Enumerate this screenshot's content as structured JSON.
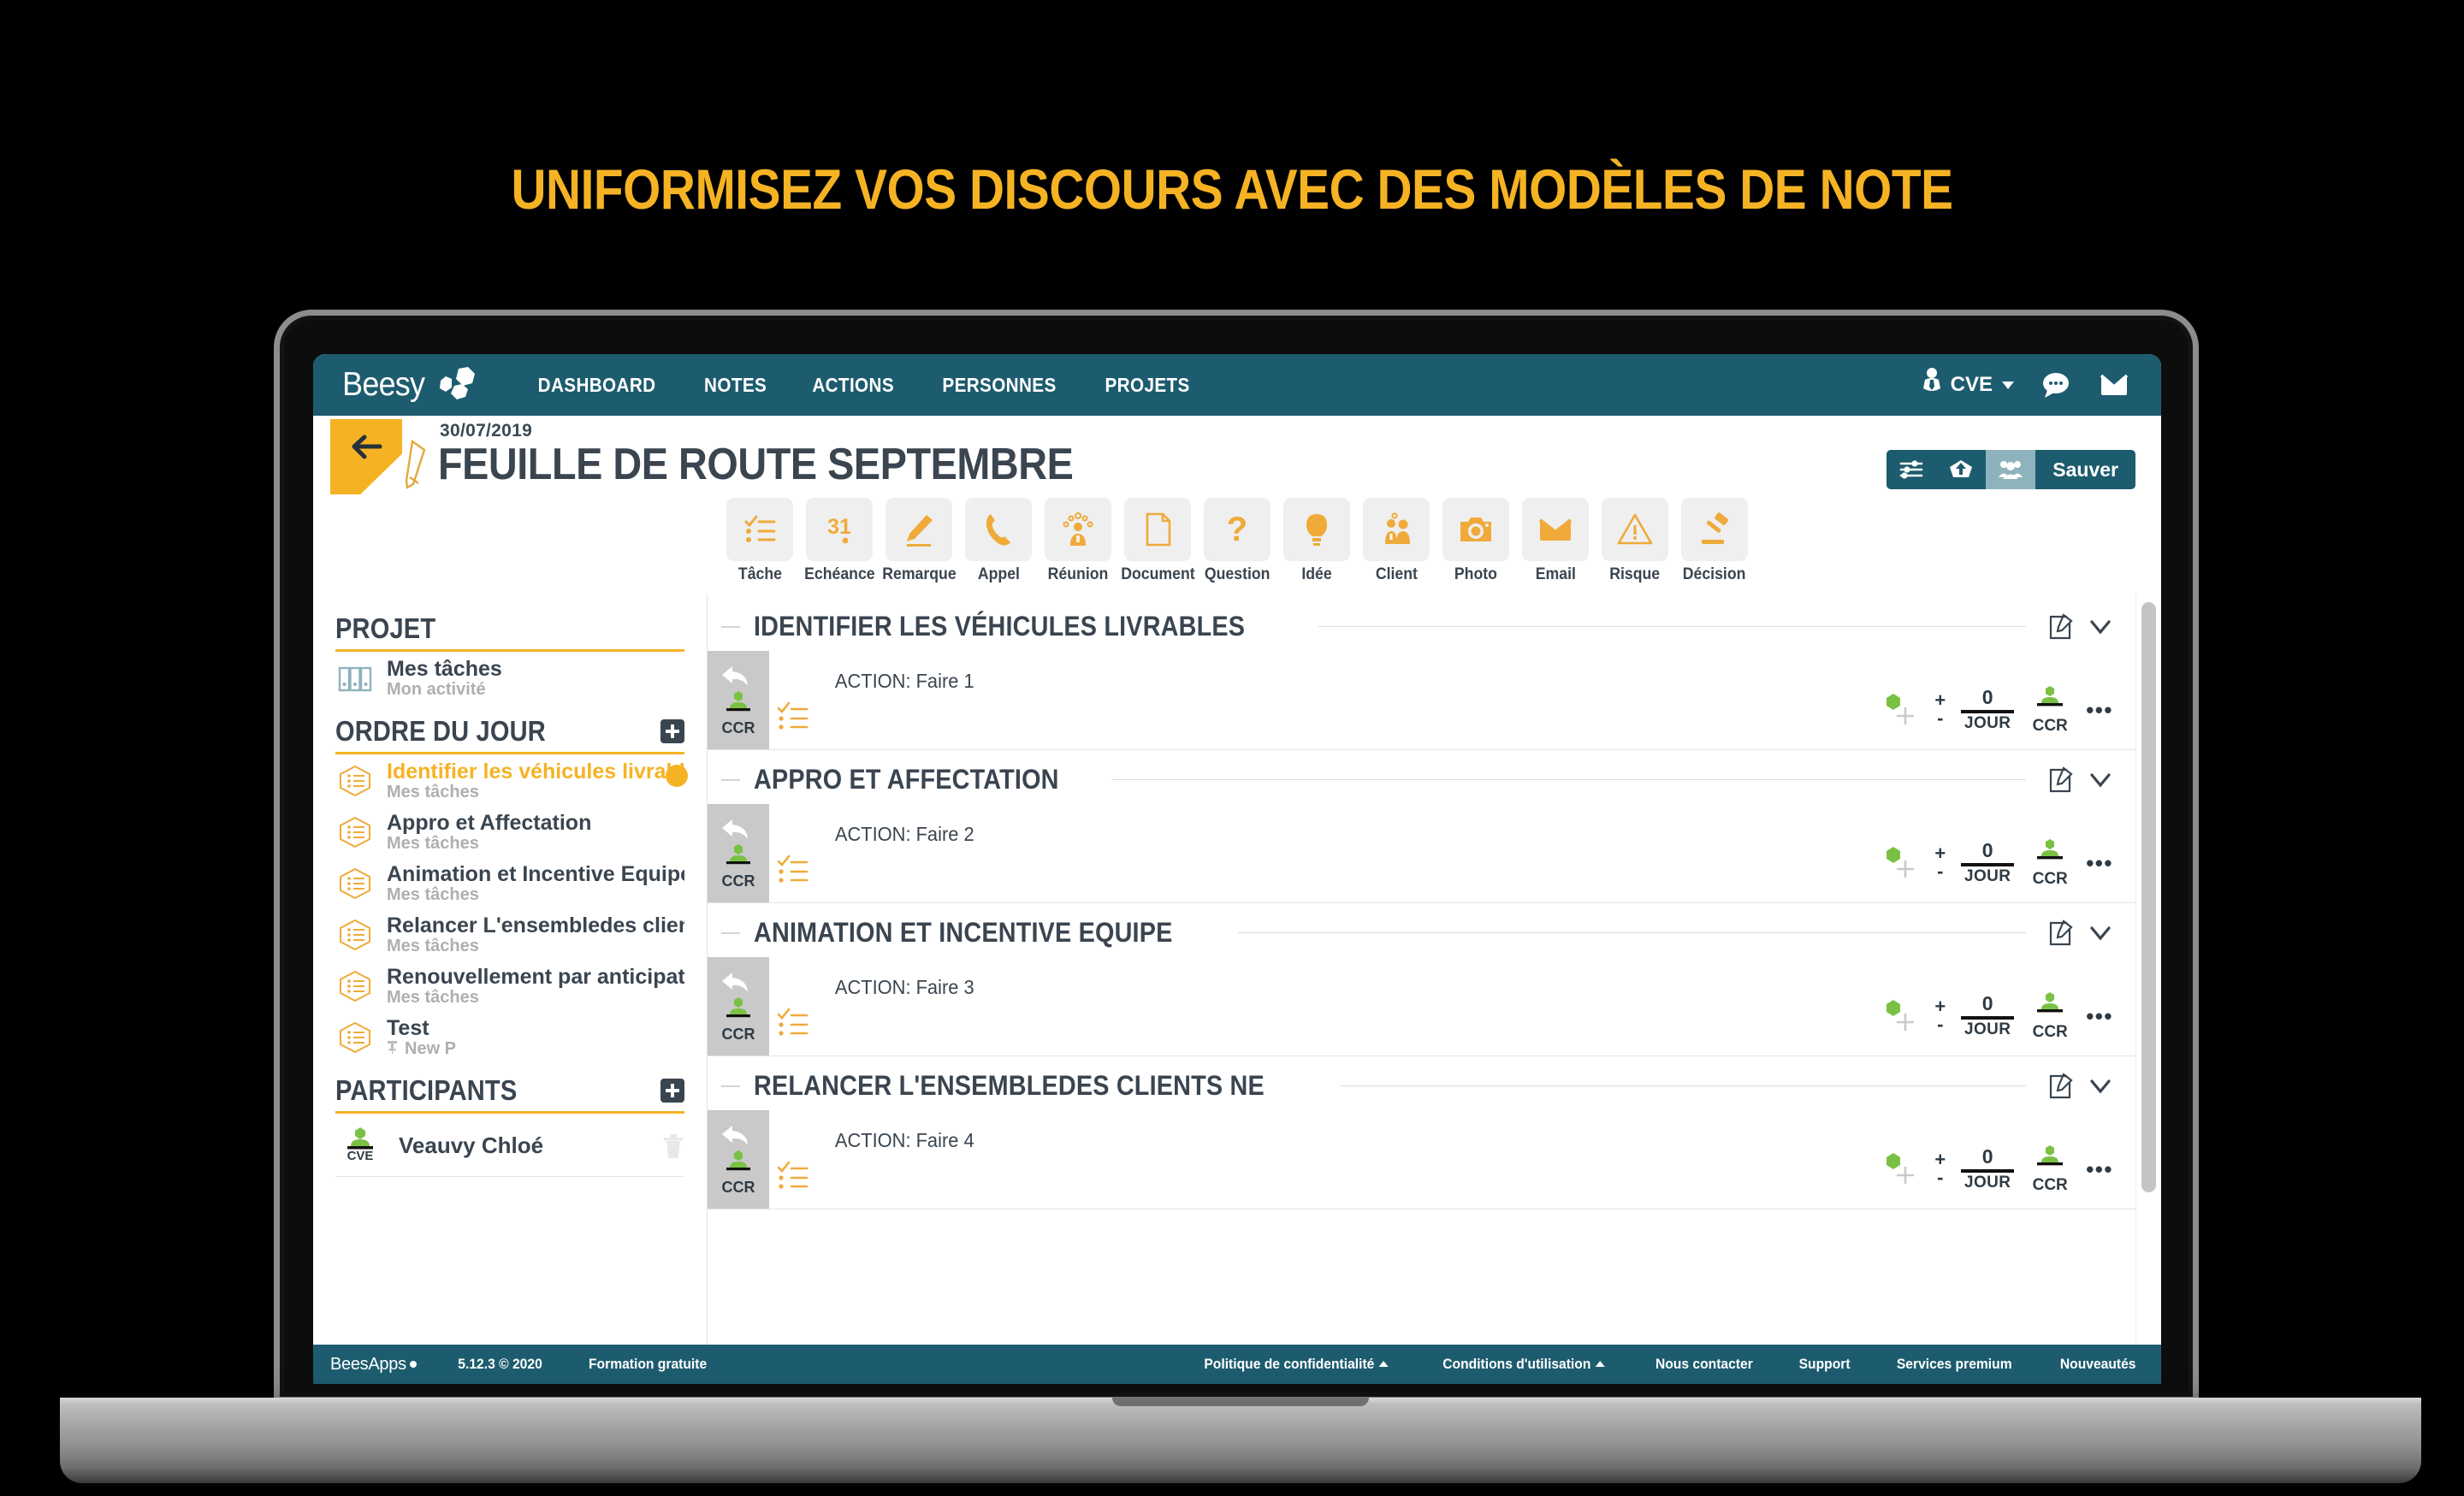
{
  "banner": {
    "headline": "UNIFORMISEZ VOS DISCOURS AVEC DES MODÈLES DE NOTE"
  },
  "colors": {
    "brand_teal": "#1D5C6E",
    "accent_yellow": "#F5B324",
    "dark_slate": "#3A4550",
    "green": "#7AC143",
    "tile_grey": "#EFEFEF",
    "gutter_grey": "#C9C9C9"
  },
  "topnav": {
    "brand": "Beesy",
    "brand_icon": "bee-hex-logo-icon",
    "links": [
      {
        "label": "DASHBOARD"
      },
      {
        "label": "NOTES"
      },
      {
        "label": "ACTIONS"
      },
      {
        "label": "PERSONNES"
      },
      {
        "label": "PROJETS"
      }
    ],
    "user": {
      "initials": "CVE",
      "avatar_icon": "user-tie-icon",
      "caret_icon": "caret-down-icon"
    },
    "icons": [
      {
        "name": "chat-bubble-icon"
      },
      {
        "name": "envelope-icon"
      }
    ]
  },
  "titlebar": {
    "back_icon": "arrow-left-icon",
    "pencil_icon": "pencil-icon",
    "date": "30/07/2019",
    "title": "FEUILLE DE ROUTE SEPTEMBRE",
    "actions": [
      {
        "name": "sliders-icon",
        "active": false
      },
      {
        "name": "upload-icon",
        "active": false
      },
      {
        "name": "people-group-icon",
        "active": true
      }
    ],
    "save_label": "Sauver"
  },
  "typebar": {
    "items": [
      {
        "label": "Tâche",
        "icon": "checklist-icon"
      },
      {
        "label": "Echéance",
        "icon": "calendar-31-icon"
      },
      {
        "label": "Remarque",
        "icon": "pen-underline-icon"
      },
      {
        "label": "Appel",
        "icon": "phone-icon"
      },
      {
        "label": "Réunion",
        "icon": "meeting-person-icon"
      },
      {
        "label": "Document",
        "icon": "document-icon"
      },
      {
        "label": "Question",
        "icon": "question-mark-icon"
      },
      {
        "label": "Idée",
        "icon": "lightbulb-icon"
      },
      {
        "label": "Client",
        "icon": "two-people-icon"
      },
      {
        "label": "Photo",
        "icon": "camera-icon"
      },
      {
        "label": "Email",
        "icon": "envelope-icon"
      },
      {
        "label": "Risque",
        "icon": "warning-triangle-icon"
      },
      {
        "label": "Décision",
        "icon": "gavel-icon"
      }
    ]
  },
  "sidebar": {
    "projet": {
      "heading": "PROJET",
      "item": {
        "title": "Mes tâches",
        "subtitle": "Mon activité",
        "icon": "binders-icon"
      }
    },
    "ordre_du_jour": {
      "heading": "ORDRE DU JOUR",
      "add_icon": "plus-square-icon",
      "items": [
        {
          "title": "Identifier les véhicules livrable",
          "subtitle": "Mes tâches",
          "icon": "agenda-hex-icon",
          "active": true
        },
        {
          "title": "Appro et Affectation",
          "subtitle": "Mes tâches",
          "icon": "agenda-hex-icon",
          "active": false
        },
        {
          "title": "Animation et Incentive Equipe",
          "subtitle": "Mes tâches",
          "icon": "agenda-hex-icon",
          "active": false
        },
        {
          "title": "Relancer L'ensembledes client",
          "subtitle": "Mes tâches",
          "icon": "agenda-hex-icon",
          "active": false
        },
        {
          "title": "Renouvellement par anticipati",
          "subtitle": "Mes tâches",
          "icon": "agenda-hex-icon",
          "active": false
        },
        {
          "title": "Test",
          "subtitle": "New P",
          "icon": "agenda-hex-icon",
          "active": false,
          "pin_icon": "pin-icon"
        }
      ]
    },
    "participants": {
      "heading": "PARTICIPANTS",
      "add_icon": "plus-square-icon",
      "items": [
        {
          "name": "Veauvy Chloé",
          "code": "CVE",
          "avatar_icon": "user-green-icon",
          "delete_icon": "trash-icon"
        }
      ]
    }
  },
  "main": {
    "groups": [
      {
        "title": "IDENTIFIER LES VÉHICULES LIVRABLES",
        "edit_icon": "edit-square-icon",
        "collapse_icon": "chevron-down-icon",
        "rows": [
          {
            "gutter_code": "CCR",
            "gutter_icon": "reply-arrow-icon",
            "type_icon": "checklist-icon",
            "text": "ACTION: Faire 1",
            "assign_icon": "add-person-icon",
            "plus": "+",
            "minus": "-",
            "metric_value": "0",
            "metric_unit": "JOUR",
            "owner_code": "CCR",
            "owner_icon": "user-green-icon",
            "more_icon": "ellipsis-icon"
          }
        ]
      },
      {
        "title": "APPRO ET AFFECTATION",
        "edit_icon": "edit-square-icon",
        "collapse_icon": "chevron-down-icon",
        "rows": [
          {
            "gutter_code": "CCR",
            "gutter_icon": "reply-arrow-icon",
            "type_icon": "checklist-icon",
            "text": "ACTION: Faire 2",
            "assign_icon": "add-person-icon",
            "plus": "+",
            "minus": "-",
            "metric_value": "0",
            "metric_unit": "JOUR",
            "owner_code": "CCR",
            "owner_icon": "user-green-icon",
            "more_icon": "ellipsis-icon"
          }
        ]
      },
      {
        "title": "ANIMATION ET INCENTIVE EQUIPE",
        "edit_icon": "edit-square-icon",
        "collapse_icon": "chevron-down-icon",
        "rows": [
          {
            "gutter_code": "CCR",
            "gutter_icon": "reply-arrow-icon",
            "type_icon": "checklist-icon",
            "text": "ACTION: Faire 3",
            "assign_icon": "add-person-icon",
            "plus": "+",
            "minus": "-",
            "metric_value": "0",
            "metric_unit": "JOUR",
            "owner_code": "CCR",
            "owner_icon": "user-green-icon",
            "more_icon": "ellipsis-icon"
          }
        ]
      },
      {
        "title": "RELANCER L'ENSEMBLEDES CLIENTS NE",
        "edit_icon": "edit-square-icon",
        "collapse_icon": "chevron-down-icon",
        "rows": [
          {
            "gutter_code": "CCR",
            "gutter_icon": "reply-arrow-icon",
            "type_icon": "checklist-icon",
            "text": "ACTION: Faire 4",
            "assign_icon": "add-person-icon",
            "plus": "+",
            "minus": "-",
            "metric_value": "0",
            "metric_unit": "JOUR",
            "owner_code": "CCR",
            "owner_icon": "user-green-icon",
            "more_icon": "ellipsis-icon"
          }
        ]
      }
    ]
  },
  "footer": {
    "brand": "BeesApps",
    "version": "5.12.3 © 2020",
    "training": "Formation gratuite",
    "links": [
      {
        "label": "Politique de confidentialité",
        "caret": true
      },
      {
        "label": "Conditions d'utilisation",
        "caret": true
      },
      {
        "label": "Nous contacter",
        "caret": false
      },
      {
        "label": "Support",
        "caret": false
      },
      {
        "label": "Services premium",
        "caret": false
      },
      {
        "label": "Nouveautés",
        "caret": false
      }
    ]
  }
}
